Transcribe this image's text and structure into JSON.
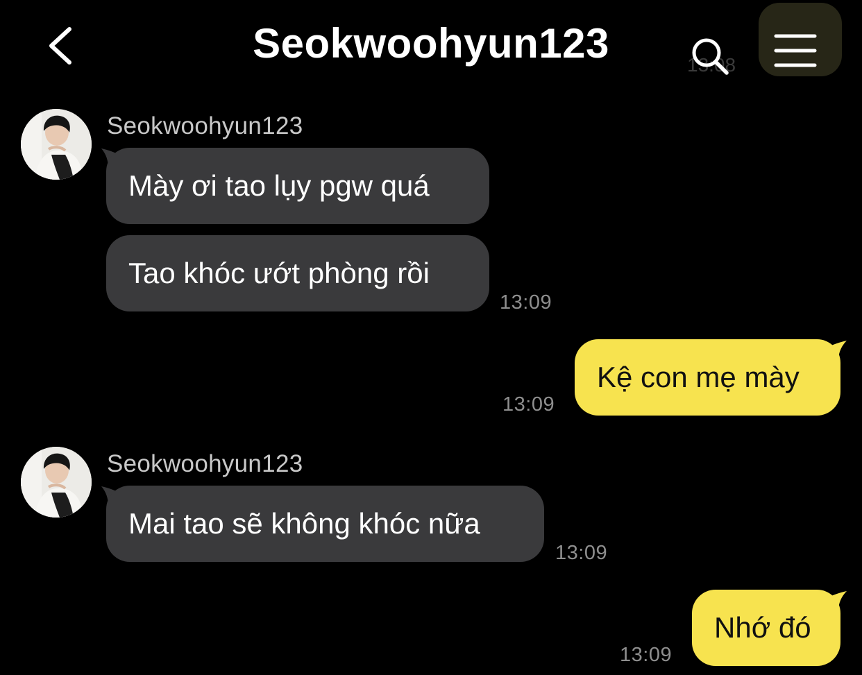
{
  "header": {
    "title": "Seokwoohyun123",
    "faded_timestamp": "13:08",
    "back_icon": "chevron-left-icon",
    "search_icon": "search-icon",
    "menu_icon": "hamburger-menu-icon"
  },
  "colors": {
    "background": "#000000",
    "incoming_bubble": "#3a3a3c",
    "outgoing_bubble": "#f7e34f",
    "timestamp": "#8e8e8e"
  },
  "messages": [
    {
      "sender": "Seokwoohyun123",
      "direction": "incoming",
      "bubbles": [
        "Mày ơi tao lụy pgw quá",
        "Tao khóc ướt phòng rồi"
      ],
      "time": "13:09"
    },
    {
      "direction": "outgoing",
      "bubbles": [
        "Kệ con mẹ mày"
      ],
      "time": "13:09"
    },
    {
      "sender": "Seokwoohyun123",
      "direction": "incoming",
      "bubbles": [
        "Mai tao sẽ không khóc nữa"
      ],
      "time": "13:09"
    },
    {
      "direction": "outgoing",
      "bubbles": [
        "Nhớ đó"
      ],
      "time": "13:09"
    }
  ]
}
